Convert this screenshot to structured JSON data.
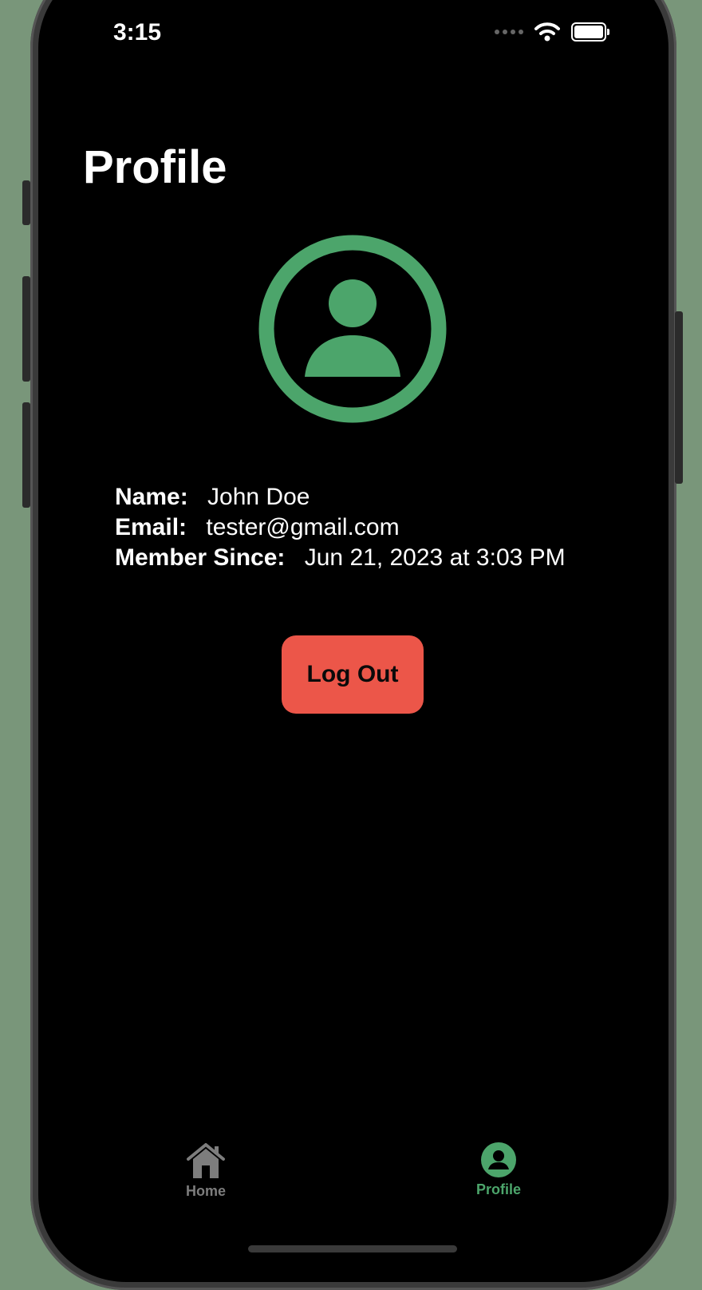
{
  "status_bar": {
    "time": "3:15"
  },
  "header": {
    "title": "Profile"
  },
  "profile": {
    "name_label": "Name:",
    "name_value": "John Doe",
    "email_label": "Email:",
    "email_value": "tester@gmail.com",
    "member_since_label": "Member Since:",
    "member_since_value": "Jun 21, 2023 at 3:03 PM"
  },
  "actions": {
    "logout_label": "Log Out"
  },
  "tabbar": {
    "items": [
      {
        "label": "Home",
        "icon": "house-icon",
        "selected": false
      },
      {
        "label": "Profile",
        "icon": "person-circle-icon",
        "selected": true
      }
    ]
  },
  "colors": {
    "accent": "#4ca56b",
    "logout": "#ec5649",
    "background": "#000000",
    "inactive_tab": "#7d7d7d"
  },
  "icons": {
    "avatar": "person-circle-icon",
    "wifi": "wifi-icon",
    "battery": "battery-icon",
    "signal": "signal-icon"
  }
}
